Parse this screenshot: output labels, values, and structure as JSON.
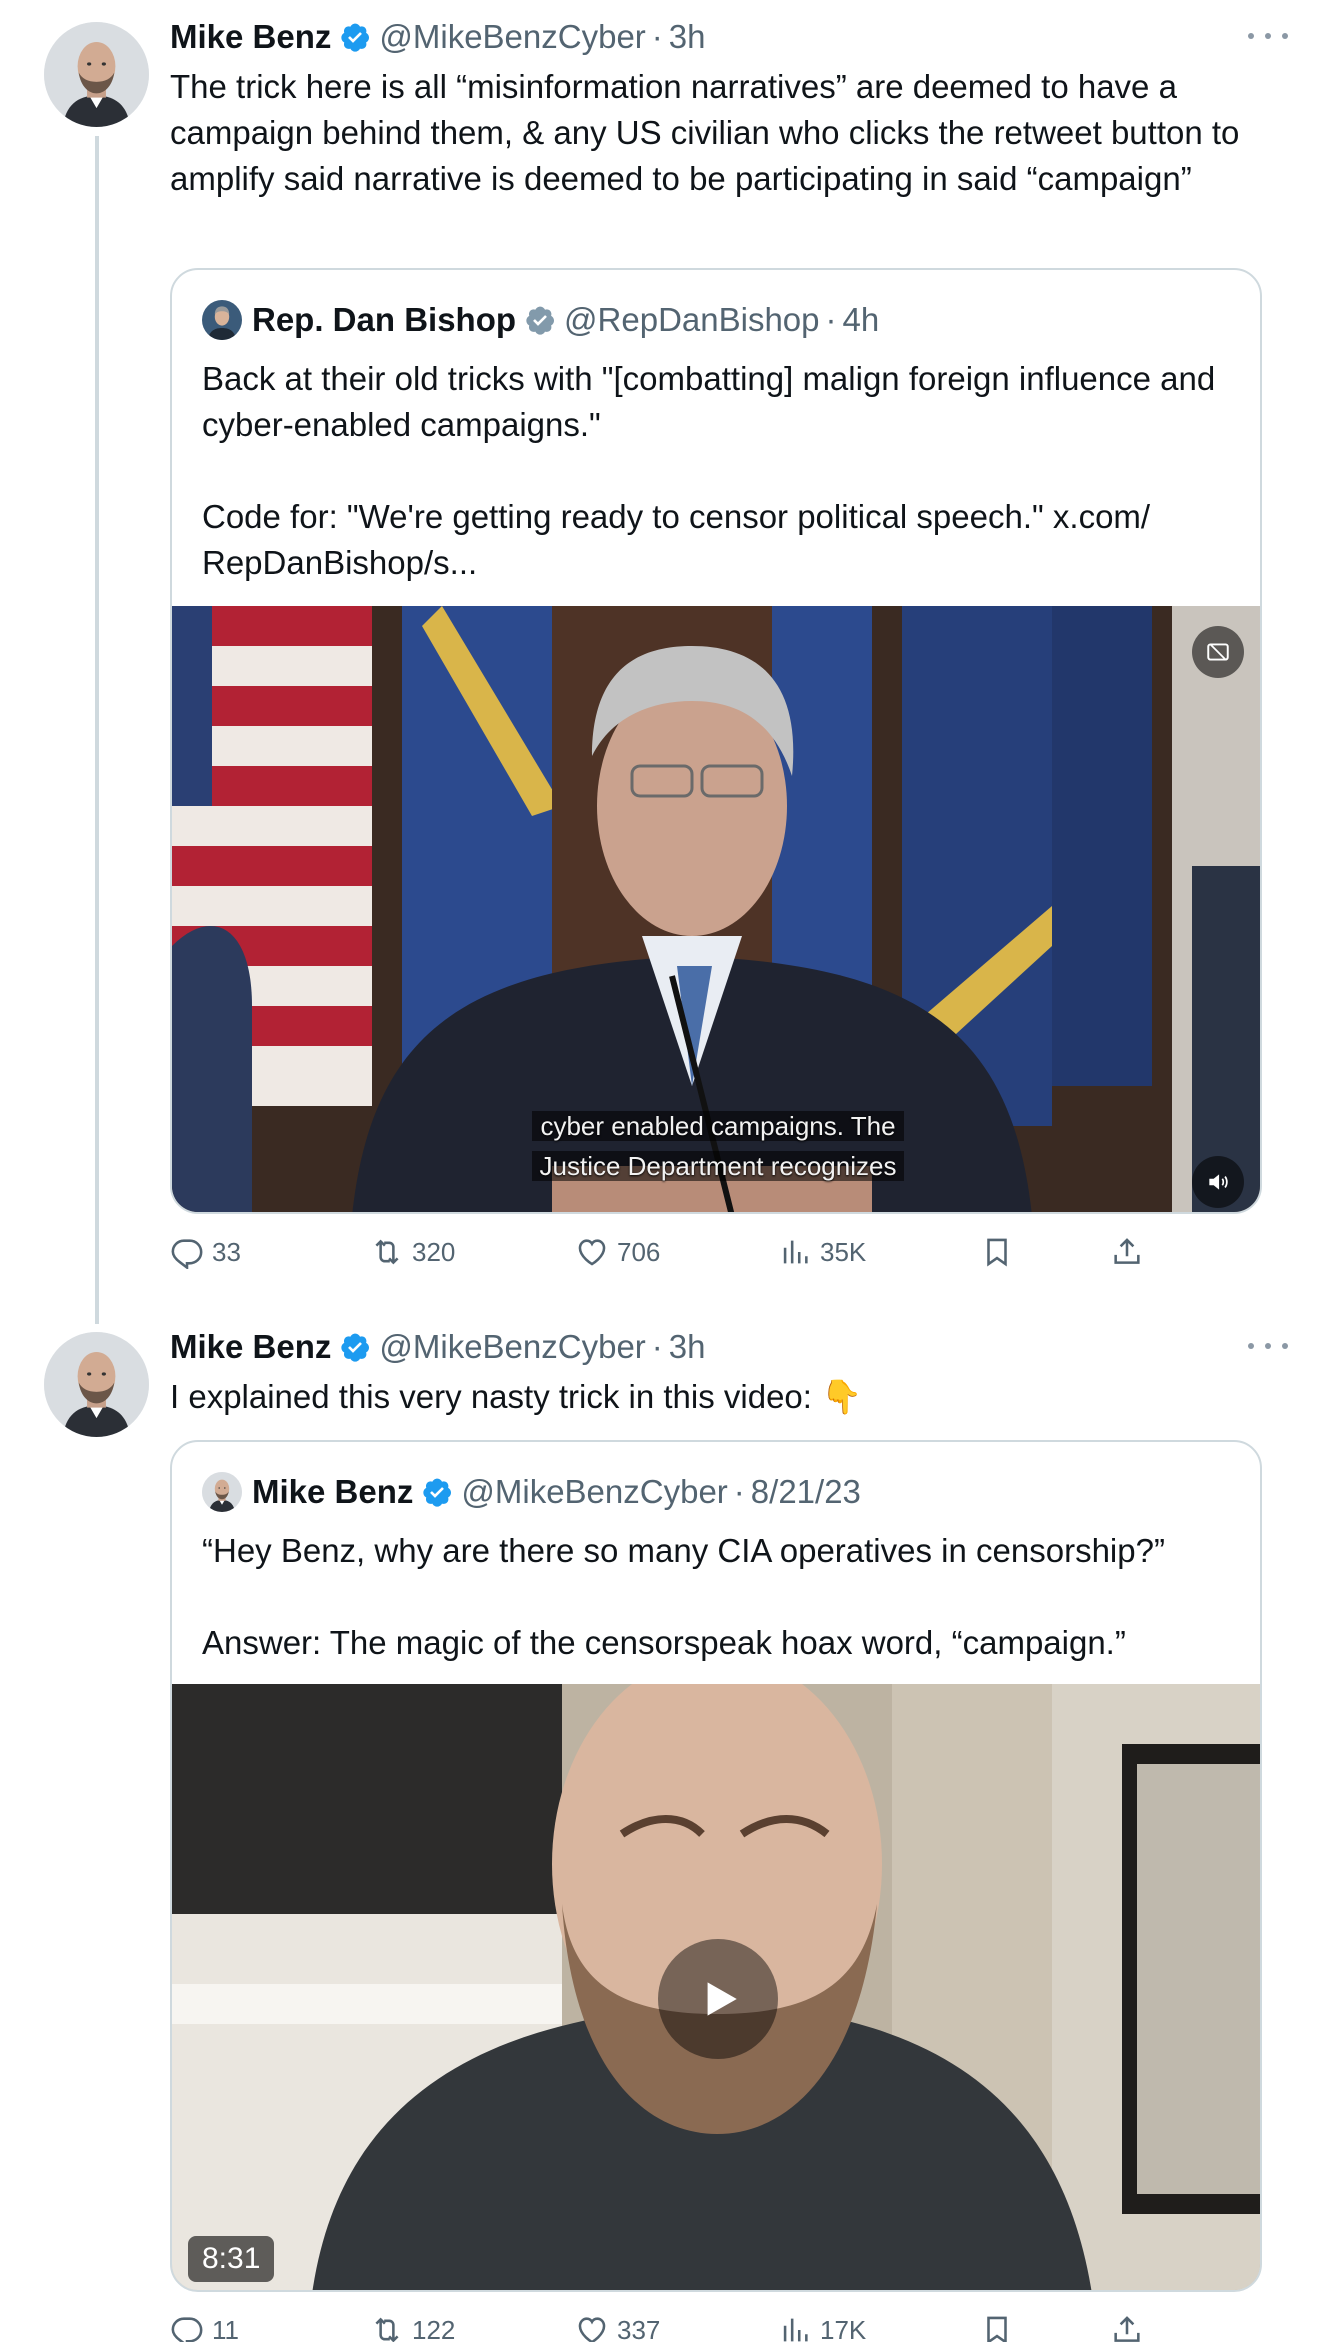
{
  "colors": {
    "accent": "#1d9bf0",
    "text_primary": "#0f1419",
    "text_secondary": "#536471",
    "border": "#cfd9de"
  },
  "tweets": [
    {
      "author_name": "Mike Benz",
      "handle": "@MikeBenzCyber",
      "separator": "·",
      "time": "3h",
      "text": "The trick here is all “misinformation narratives” are deemed to have a campaign behind them, & any US civilian who clicks the retweet button to amplify said narrative is deemed to be participating in said “campaign”",
      "quote": {
        "author_name": "Rep. Dan Bishop",
        "handle": "@RepDanBishop",
        "separator": "·",
        "time": "4h",
        "text": "Back at their old tricks with \"[combatting] malign foreign influence and cyber-enabled campaigns.\"\n\nCode for: \"We're getting ready to censor political speech.\" x.com/\nRepDanBishop/s...",
        "video_caption_line1": "cyber enabled campaigns. The",
        "video_caption_line2": "Justice Department recognizes"
      },
      "actions": {
        "replies": "33",
        "reposts": "320",
        "likes": "706",
        "views": "35K"
      }
    },
    {
      "author_name": "Mike Benz",
      "handle": "@MikeBenzCyber",
      "separator": "·",
      "time": "3h",
      "text": "I explained this very nasty trick in this video:  👇",
      "quote": {
        "author_name": "Mike Benz",
        "handle": "@MikeBenzCyber",
        "separator": "·",
        "time": "8/21/23",
        "text": "“Hey Benz, why are there so many CIA operatives in censorship?”\n\nAnswer: The magic of the censorspeak hoax word, “campaign.”",
        "video_duration": "8:31"
      },
      "actions": {
        "replies": "11",
        "reposts": "122",
        "likes": "337",
        "views": "17K"
      }
    }
  ]
}
